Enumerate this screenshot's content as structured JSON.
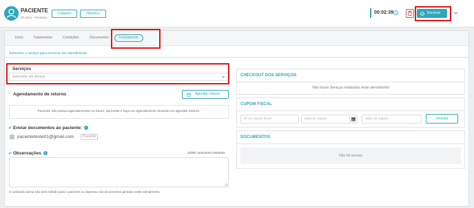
{
  "header": {
    "patient_name": "PACIENTE",
    "patient_meta": "30 anos - Feminino",
    "cadastro_label": "Cadastro",
    "historico_label": "Histórico",
    "timer": "00:02:39",
    "end_label": "Encerrar",
    "icons": [
      "user-avatar-icon",
      "clock-icon",
      "trash-icon",
      "check-circle-icon",
      "chevron-down-icon"
    ]
  },
  "tabs": [
    {
      "label": "Início"
    },
    {
      "label": "Tratamentos"
    },
    {
      "label": "Condições"
    },
    {
      "label": "Documentos"
    },
    {
      "label": "Fechamento",
      "active": true
    }
  ],
  "hint": "Selecione o serviço para encerrar seu atendimento",
  "left": {
    "services_title": "Serviços",
    "services_placeholder": "Selecione um serviço",
    "return_title": "Agendamento de retorno",
    "schedule_button": "Agendar retorno",
    "no_appointments": "Paciente não possui agendamentos no futuro, aproveite e faça um agendamento clicando em agendar retorno.",
    "send_docs_title": "Enviar documentos ao paciente:",
    "email": "pacienteteste01@gmail.com",
    "email_tag": "Paciente",
    "observations_title": "Observações",
    "chars_left": "10000 caracteres restantes",
    "footnote": "O conteúdo acima não será exibido para o paciente ou impresso nos documentos gerados neste atendimento."
  },
  "right": {
    "checkout_title": "CHECKOUT DOS SERVIÇOS",
    "checkout_empty": "Não houve Serviços realizados neste atendimento",
    "coupon_title": "CUPOM FISCAL",
    "coupon_number_placeholder": "Nº do cupom fiscal",
    "coupon_date_placeholder": "Data do cupom",
    "coupon_value_placeholder": "Valor do cupom",
    "link_label": "Vincular",
    "documents_title": "DOCUMENTOS",
    "documents_empty": "Não há anexos"
  },
  "colors": {
    "accent": "#2ea8b8",
    "highlight": "#e01616",
    "danger": "#d9534f"
  }
}
